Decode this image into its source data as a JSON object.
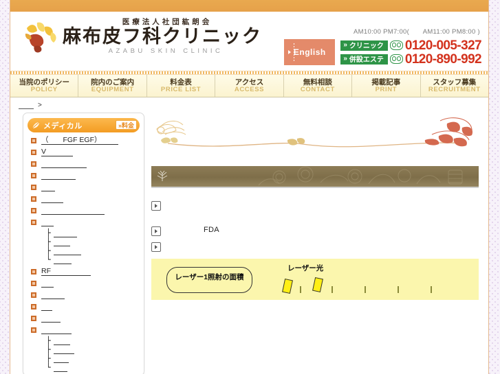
{
  "site": {
    "corp_name": "医療法人社団紘朗会",
    "clinic_name": "麻布皮フ科クリニック",
    "clinic_name_en": "AZABU SKIN CLINIC",
    "hours": "AM10:00 PM7:00(　　AM11:00 PM8:00 )",
    "english_button": "English",
    "logo_icon": "tulip-flower-logo",
    "accent_orange": "#e8a44e",
    "accent_green": "#2e9447",
    "accent_red": "#d3321d",
    "accent_salmon": "#e48a6a"
  },
  "tel": [
    {
      "tag": "クリニック",
      "chevron": "»",
      "number": "0120-005-327",
      "icon": "freedial-icon"
    },
    {
      "tag": "併設エステ",
      "chevron": "»",
      "number": "0120-890-992",
      "icon": "freedial-icon"
    }
  ],
  "nav": {
    "items": [
      {
        "ja": "当院のポリシー",
        "en": "POLICY"
      },
      {
        "ja": "院内のご案内",
        "en": "EQUIPMENT"
      },
      {
        "ja": "料金表",
        "en": "PRICE LIST"
      },
      {
        "ja": "アクセス",
        "en": "ACCESS"
      },
      {
        "ja": "無料相談",
        "en": "CONTACT"
      },
      {
        "ja": "掲載記事",
        "en": "PRINT"
      },
      {
        "ja": "スタッフ募集",
        "en": "RECRUITMENT"
      }
    ]
  },
  "breadcrumb": {
    "home": "",
    "separator": ">",
    "current": ""
  },
  "sidebar": {
    "title": "メディカル",
    "title_icon": "leaf-icon",
    "price_badge": "»料金",
    "items": [
      {
        "label": "（　　FGF EGF）",
        "width": 112,
        "children": []
      },
      {
        "label": "V",
        "width": 46,
        "children": []
      },
      {
        "label": "",
        "width": 66,
        "children": []
      },
      {
        "label": "",
        "width": 50,
        "children": []
      },
      {
        "label": "",
        "width": 20,
        "children": []
      },
      {
        "label": "",
        "width": 32,
        "children": []
      },
      {
        "label": "",
        "width": 92,
        "children": []
      },
      {
        "label": "",
        "width": 18,
        "children": [
          {
            "branch": "├",
            "label": "",
            "width": 34
          },
          {
            "branch": "├",
            "label": "",
            "width": 24
          },
          {
            "branch": "├",
            "label": "",
            "width": 40
          },
          {
            "branch": "└",
            "label": "",
            "width": 26
          }
        ]
      },
      {
        "label": "RF",
        "width": 72,
        "children": []
      },
      {
        "label": "",
        "width": 18,
        "children": []
      },
      {
        "label": "",
        "width": 34,
        "children": []
      },
      {
        "label": "",
        "width": 16,
        "children": []
      },
      {
        "label": "",
        "width": 28,
        "children": []
      },
      {
        "label": "",
        "width": 44,
        "children": [
          {
            "branch": "├",
            "label": "",
            "width": 24
          },
          {
            "branch": "├",
            "label": "",
            "width": 30
          },
          {
            "branch": "├",
            "label": "",
            "width": 22
          },
          {
            "branch": "└",
            "label": "",
            "width": 20
          }
        ]
      }
    ]
  },
  "main": {
    "band_title": "",
    "band_icon": "leaf-icon",
    "paragraphs": [
      {
        "icon": "play-icon",
        "text": ""
      },
      {
        "icon": "play-icon",
        "text": "FDA",
        "indent": true
      },
      {
        "icon": "play-icon",
        "text": ""
      }
    ]
  },
  "diagram": {
    "box_label": "レーザー1照射の面積",
    "beam_label": "レーザー光",
    "bg_color": "#fbf6ad",
    "beam_color": "#ffef14"
  }
}
